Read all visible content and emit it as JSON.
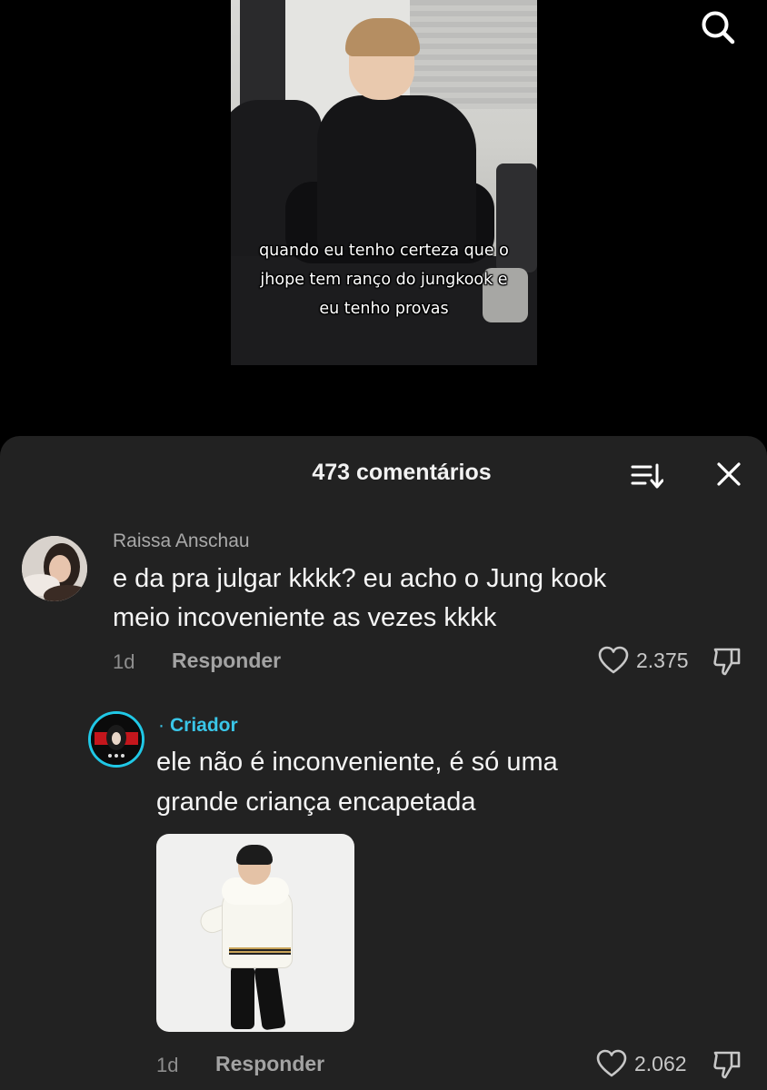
{
  "video": {
    "caption": "quando eu tenho certeza que o jhope tem ranço do jungkook e eu tenho provas"
  },
  "comments_sheet": {
    "title": "473 comentários"
  },
  "comments": [
    {
      "author": "Raissa Anschau",
      "text_line1": "e da pra julgar kkkk? eu acho o Jung kook",
      "text_line2": "meio incoveniente as vezes kkkk",
      "age": "1d",
      "reply_label": "Responder",
      "likes": "2.375"
    },
    {
      "author_badge": "·",
      "author": "Criador",
      "text_line1": "ele não é inconveniente, é só uma",
      "text_line2": "grande criança encapetada",
      "age": "1d",
      "reply_label": "Responder",
      "likes": "2.062"
    }
  ],
  "colors": {
    "background": "#000000",
    "sheet": "#222222",
    "creator_accent": "#3ac6e8"
  },
  "icons": [
    "search-icon",
    "sort-icon",
    "close-icon",
    "heart-icon",
    "dislike-icon"
  ]
}
